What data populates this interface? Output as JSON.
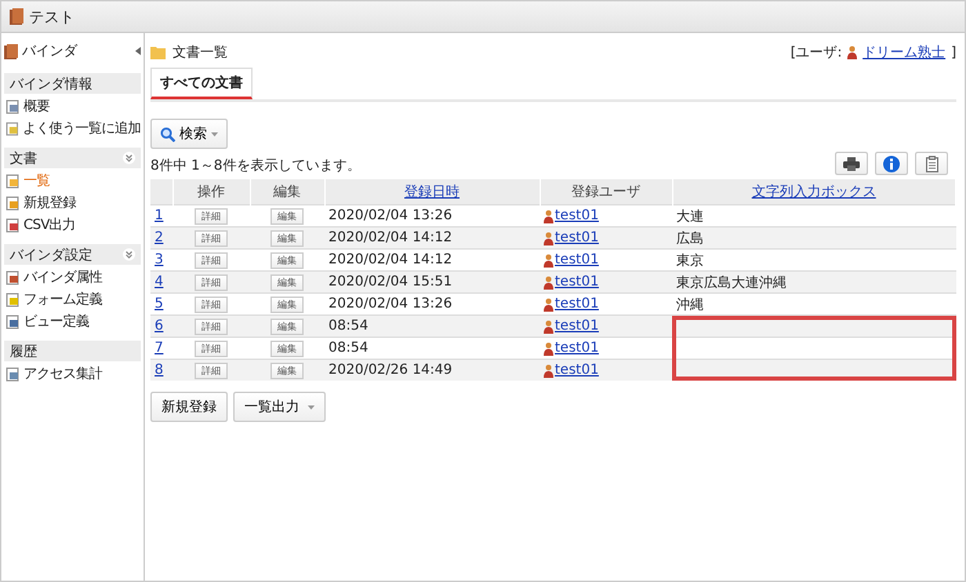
{
  "app": {
    "title": "テスト"
  },
  "sidebar": {
    "title": "バインダ",
    "sections": [
      {
        "title": "バインダ情報",
        "collapsible": false,
        "items": [
          {
            "label": "概要",
            "selected": false
          },
          {
            "label": "よく使う一覧に追加",
            "selected": false
          }
        ]
      },
      {
        "title": "文書",
        "collapsible": true,
        "items": [
          {
            "label": "一覧",
            "selected": true
          },
          {
            "label": "新規登録",
            "selected": false
          },
          {
            "label": "CSV出力",
            "selected": false
          }
        ]
      },
      {
        "title": "バインダ設定",
        "collapsible": true,
        "items": [
          {
            "label": "バインダ属性",
            "selected": false
          },
          {
            "label": "フォーム定義",
            "selected": false
          },
          {
            "label": "ビュー定義",
            "selected": false
          }
        ]
      },
      {
        "title": "履歴",
        "collapsible": false,
        "items": [
          {
            "label": "アクセス集計",
            "selected": false
          }
        ]
      }
    ]
  },
  "page": {
    "title": "文書一覧",
    "user_label": "[ユーザ:",
    "user_name": "ドリーム熟士",
    "user_close": "]"
  },
  "tabs": [
    {
      "label": "すべての文書",
      "selected": true
    }
  ],
  "search_button": "検索",
  "count_text": "8件中 1～8件を表示しています。",
  "table": {
    "columns": [
      {
        "label": "操作",
        "link": false
      },
      {
        "label": "編集",
        "link": false
      },
      {
        "label": "登録日時",
        "link": true
      },
      {
        "label": "登録ユーザ",
        "link": false
      },
      {
        "label": "文字列入力ボックス",
        "link": true
      }
    ],
    "rows": [
      {
        "no": "1",
        "detail": "詳細",
        "edit": "編集",
        "date": "2020/02/04 13:26",
        "user": "test01",
        "text": "大連",
        "highlighted": false
      },
      {
        "no": "2",
        "detail": "詳細",
        "edit": "編集",
        "date": "2020/02/04 14:12",
        "user": "test01",
        "text": "広島",
        "highlighted": false
      },
      {
        "no": "3",
        "detail": "詳細",
        "edit": "編集",
        "date": "2020/02/04 14:12",
        "user": "test01",
        "text": "東京",
        "highlighted": false
      },
      {
        "no": "4",
        "detail": "詳細",
        "edit": "編集",
        "date": "2020/02/04 15:51",
        "user": "test01",
        "text": "東京広島大連沖縄",
        "highlighted": false
      },
      {
        "no": "5",
        "detail": "詳細",
        "edit": "編集",
        "date": "2020/02/04 13:26",
        "user": "test01",
        "text": "沖縄",
        "highlighted": false
      },
      {
        "no": "6",
        "detail": "詳細",
        "edit": "編集",
        "date": "08:54",
        "user": "test01",
        "highlighted": true
      },
      {
        "no": "7",
        "detail": "詳細",
        "edit": "編集",
        "date": "08:54",
        "user": "test01",
        "highlighted": true
      },
      {
        "no": "8",
        "detail": "詳細",
        "edit": "編集",
        "date": "2020/02/26 14:49",
        "user": "test01",
        "highlighted": true
      }
    ]
  },
  "bottom_buttons": [
    {
      "label": "新規登録",
      "dropdown": false
    },
    {
      "label": "一覧出力",
      "dropdown": true
    }
  ]
}
